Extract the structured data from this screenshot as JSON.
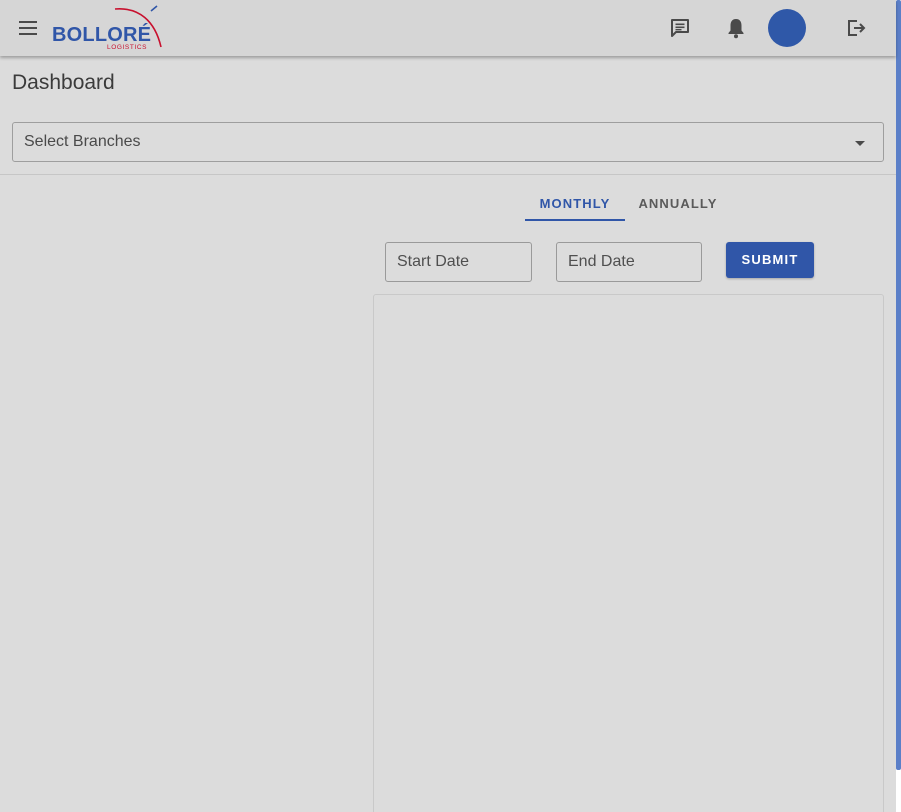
{
  "header": {
    "logo_text": "BOLLORÉ",
    "logo_subtext": "LOGISTICS",
    "icons": [
      "menu-icon",
      "chat-icon",
      "bell-icon",
      "logout-icon"
    ]
  },
  "page": {
    "title": "Dashboard"
  },
  "branches": {
    "label": "Select Branches"
  },
  "tabs": [
    {
      "label": "MONTHLY",
      "selected": true
    },
    {
      "label": "ANNUALLY",
      "selected": false
    }
  ],
  "filters": {
    "start_date_placeholder": "Start Date",
    "end_date_placeholder": "End Date",
    "submit_label": "SUBMIT"
  },
  "colors": {
    "primary": "#3056a8",
    "background": "#dcdcdc",
    "logo_red": "#c8102e"
  }
}
